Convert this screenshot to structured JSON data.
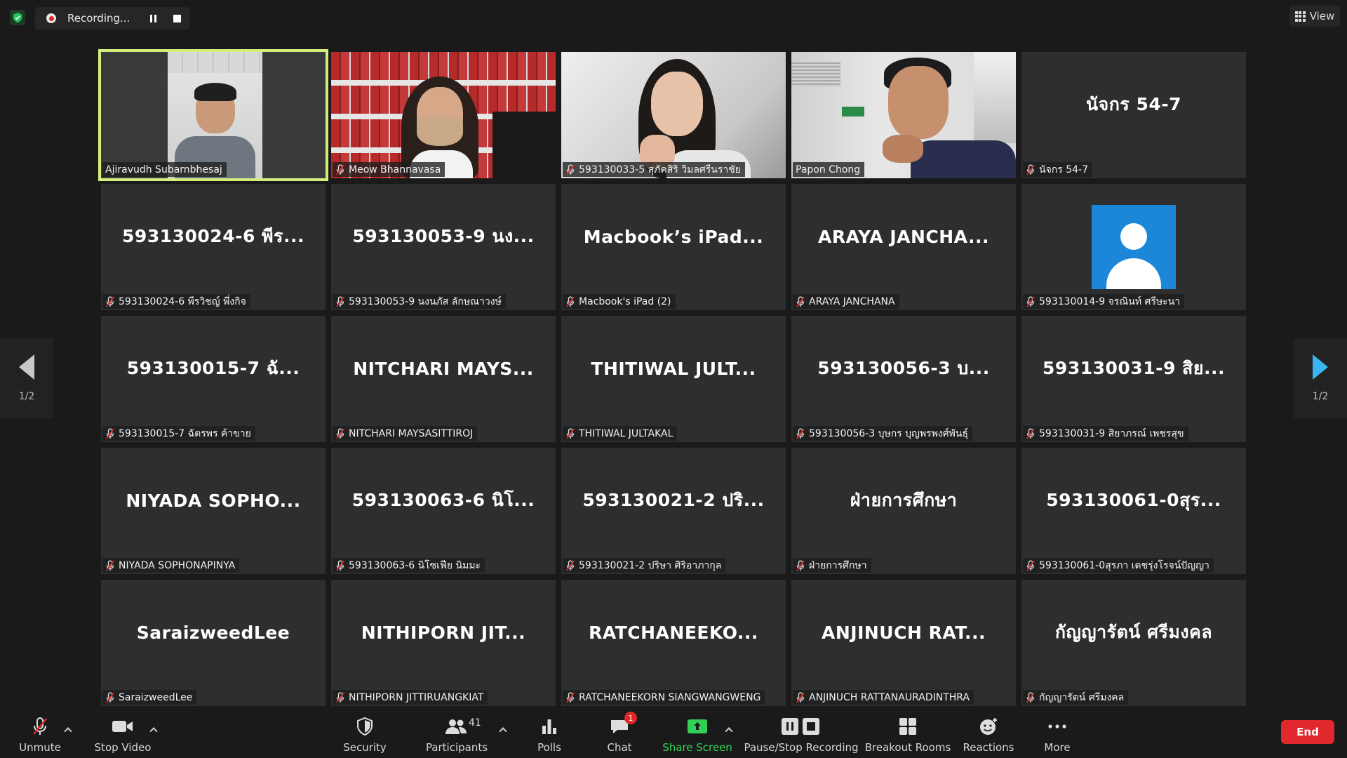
{
  "top": {
    "recording_label": "Recording...",
    "view_label": "View"
  },
  "pagination": {
    "left_page": "1/2",
    "right_page": "1/2"
  },
  "tiles": [
    {
      "big": "",
      "label": "Ajiravudh Subarnbhesaj",
      "muted": false,
      "video": "scene-1",
      "active": true
    },
    {
      "big": "",
      "label": "Meow Bhannavasa",
      "muted": true,
      "video": "scene-2"
    },
    {
      "big": "",
      "label": "593130033-5 สุภัคสิริ วิมลศรีนราชัย",
      "muted": true,
      "video": "scene-3"
    },
    {
      "big": "",
      "label": "Papon Chong",
      "muted": false,
      "video": "scene-4"
    },
    {
      "big": "นัจกร 54-7",
      "label": "นัจกร 54-7",
      "muted": true
    },
    {
      "big": "593130024-6 พีร...",
      "label": "593130024-6 พีรวิชญ์ พึ่งกิจ",
      "muted": true
    },
    {
      "big": "593130053-9 นง...",
      "label": "593130053-9 นงนภัส ลักษณาวงษ์",
      "muted": true
    },
    {
      "big": "Macbook’s iPad...",
      "label": "Macbook's iPad (2)",
      "muted": true
    },
    {
      "big": "ARAYA JANCHA...",
      "label": "ARAYA JANCHANA",
      "muted": true
    },
    {
      "big": "",
      "label": "593130014-9 จรณินท์ ศรีษะนา",
      "muted": true,
      "avatar": true
    },
    {
      "big": "593130015-7 ฉั...",
      "label": "593130015-7 ฉัตรพร ค้าขาย",
      "muted": true
    },
    {
      "big": "NITCHARI MAYS...",
      "label": "NITCHARI MAYSASITTIROJ",
      "muted": true
    },
    {
      "big": "THITIWAL JULT...",
      "label": "THITIWAL JULTAKAL",
      "muted": true
    },
    {
      "big": "593130056-3 บ...",
      "label": "593130056-3 บุษกร บุญพรพงศ์พันธุ์",
      "muted": true
    },
    {
      "big": "593130031-9 สิย...",
      "label": "593130031-9 สิยาภรณ์ เพชรสุข",
      "muted": true
    },
    {
      "big": "NIYADA SOPHO...",
      "label": "NIYADA SOPHONAPINYA",
      "muted": true
    },
    {
      "big": "593130063-6 นิโ...",
      "label": "593130063-6 นิโซเฟีย นิมมะ",
      "muted": true
    },
    {
      "big": "593130021-2 ปริ...",
      "label": "593130021-2 ปริษา ศิริอาภากุล",
      "muted": true
    },
    {
      "big": "ฝ่ายการศึกษา",
      "label": "ฝ่ายการศึกษา",
      "muted": true
    },
    {
      "big": "593130061-0สุร...",
      "label": "593130061-0สุรภา เดชรุ่งโรจน์ปัญญา",
      "muted": true
    },
    {
      "big": "SaraizweedLee",
      "label": "SaraizweedLee",
      "muted": true
    },
    {
      "big": "NITHIPORN JIT...",
      "label": "NITHIPORN JITTIRUANGKIAT",
      "muted": true
    },
    {
      "big": "RATCHANEEKO...",
      "label": "RATCHANEEKORN SIANGWANGWENG",
      "muted": true
    },
    {
      "big": "ANJINUCH RAT...",
      "label": "ANJINUCH RATTANAURADINTHRA",
      "muted": true
    },
    {
      "big": "กัญญารัตน์ ศรีมงคล",
      "label": "กัญญารัตน์ ศรีมงคล",
      "muted": true
    }
  ],
  "toolbar": {
    "unmute": "Unmute",
    "stop_video": "Stop Video",
    "security": "Security",
    "participants": "Participants",
    "participants_count": "41",
    "polls": "Polls",
    "chat": "Chat",
    "chat_badge": "1",
    "share_screen": "Share Screen",
    "pause_stop_recording": "Pause/Stop Recording",
    "breakout_rooms": "Breakout Rooms",
    "reactions": "Reactions",
    "more": "More",
    "end": "End"
  },
  "colors": {
    "background": "#1a1a1a",
    "tile": "#2e2e2e",
    "active_speaker": "#d4ee7e",
    "share_green": "#31d158",
    "end_red": "#e0282d",
    "nav_blue": "#38b6ef"
  }
}
